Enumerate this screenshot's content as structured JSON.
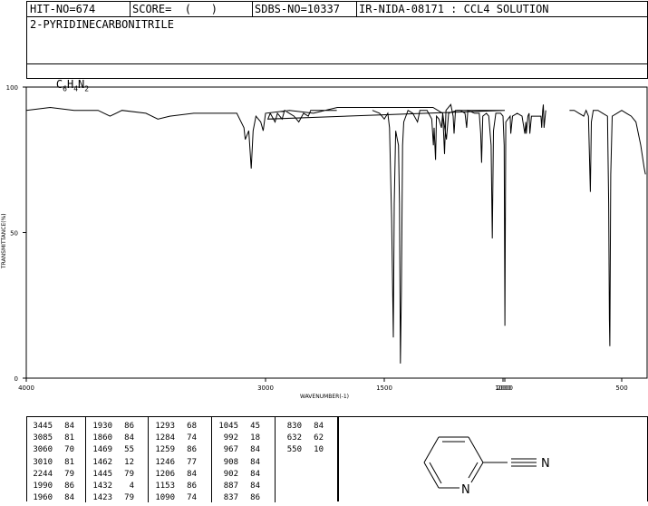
{
  "header": {
    "hit_no": "HIT-NO=674",
    "score": "SCORE=  (   )",
    "sdbs_no": "SDBS-NO=10337",
    "ir_info": "IR-NIDA-08171 : CCL4 SOLUTION"
  },
  "compound": {
    "name": "2-PYRIDINECARBONITRILE",
    "formula_parts": [
      "C",
      "6",
      "H",
      "4",
      "N",
      "2"
    ]
  },
  "chart_data": {
    "type": "line",
    "xlabel": "WAVENUMBER(-1)",
    "ylabel": "TRANSMITTANCE(%)",
    "x_reversed": true,
    "xlim": [
      4000,
      400
    ],
    "ylim": [
      0,
      100
    ],
    "x_ticks": [
      4000,
      3000,
      2000,
      1500,
      1000,
      500
    ],
    "y_ticks": [
      0,
      50,
      100
    ],
    "segments": [
      [
        [
          4000,
          92
        ],
        [
          3900,
          93
        ],
        [
          3800,
          92
        ],
        [
          3700,
          92
        ],
        [
          3650,
          90
        ],
        [
          3600,
          92
        ],
        [
          3500,
          91
        ],
        [
          3450,
          89
        ],
        [
          3400,
          90
        ],
        [
          3300,
          91
        ],
        [
          3200,
          91
        ],
        [
          3120,
          91
        ],
        [
          3090,
          86
        ],
        [
          3085,
          82
        ],
        [
          3070,
          85
        ],
        [
          3060,
          72
        ],
        [
          3052,
          85
        ],
        [
          3040,
          90
        ],
        [
          3020,
          88
        ],
        [
          3010,
          85
        ],
        [
          3000,
          91
        ],
        [
          2900,
          92
        ],
        [
          2800,
          91
        ],
        [
          2700,
          93
        ],
        [
          2500,
          93
        ],
        [
          2300,
          93
        ],
        [
          2260,
          91
        ],
        [
          2244,
          82
        ],
        [
          2235,
          91
        ],
        [
          2200,
          92
        ],
        [
          2100,
          92
        ],
        [
          2050,
          92
        ],
        [
          2000,
          92
        ],
        [
          1990,
          89
        ],
        [
          1980,
          91
        ],
        [
          1960,
          88
        ],
        [
          1950,
          91
        ],
        [
          1930,
          89
        ],
        [
          1920,
          92
        ],
        [
          1900,
          91
        ],
        [
          1880,
          90
        ],
        [
          1860,
          88
        ],
        [
          1840,
          91
        ],
        [
          1820,
          90
        ],
        [
          1810,
          92
        ],
        [
          1780,
          92
        ],
        [
          1700,
          92
        ]
      ],
      [
        [
          1550,
          92
        ],
        [
          1520,
          91
        ],
        [
          1500,
          89
        ],
        [
          1485,
          91
        ],
        [
          1478,
          86
        ],
        [
          1469,
          55
        ],
        [
          1466,
          38
        ],
        [
          1462,
          14
        ],
        [
          1458,
          60
        ],
        [
          1452,
          85
        ],
        [
          1445,
          82
        ],
        [
          1440,
          80
        ],
        [
          1436,
          60
        ],
        [
          1432,
          5
        ],
        [
          1428,
          30
        ],
        [
          1423,
          80
        ],
        [
          1418,
          88
        ],
        [
          1400,
          92
        ],
        [
          1380,
          91
        ],
        [
          1360,
          88
        ],
        [
          1350,
          92
        ],
        [
          1320,
          92
        ],
        [
          1300,
          89
        ],
        [
          1293,
          80
        ],
        [
          1290,
          86
        ],
        [
          1284,
          75
        ],
        [
          1280,
          90
        ],
        [
          1270,
          89
        ],
        [
          1259,
          86
        ],
        [
          1254,
          91
        ],
        [
          1246,
          77
        ],
        [
          1240,
          92
        ],
        [
          1220,
          94
        ],
        [
          1210,
          90
        ],
        [
          1206,
          84
        ],
        [
          1200,
          92
        ],
        [
          1180,
          92
        ],
        [
          1160,
          91
        ],
        [
          1153,
          86
        ],
        [
          1148,
          92
        ],
        [
          1120,
          91
        ],
        [
          1100,
          91
        ],
        [
          1094,
          84
        ],
        [
          1090,
          74
        ],
        [
          1085,
          90
        ],
        [
          1070,
          91
        ],
        [
          1060,
          90
        ],
        [
          1050,
          80
        ],
        [
          1045,
          48
        ],
        [
          1040,
          85
        ],
        [
          1030,
          91
        ],
        [
          1010,
          91
        ],
        [
          1000,
          90
        ],
        [
          995,
          80
        ],
        [
          992,
          18
        ],
        [
          988,
          88
        ],
        [
          970,
          90
        ],
        [
          967,
          84
        ],
        [
          960,
          90
        ],
        [
          940,
          91
        ],
        [
          920,
          90
        ],
        [
          908,
          84
        ],
        [
          904,
          88
        ],
        [
          902,
          84
        ],
        [
          895,
          90
        ],
        [
          890,
          91
        ],
        [
          887,
          84
        ],
        [
          880,
          90
        ],
        [
          860,
          90
        ],
        [
          840,
          90
        ],
        [
          837,
          86
        ],
        [
          833,
          92
        ],
        [
          830,
          94
        ],
        [
          827,
          86
        ],
        [
          820,
          92
        ]
      ],
      [
        [
          720,
          92
        ],
        [
          700,
          92
        ],
        [
          680,
          91
        ],
        [
          660,
          90
        ],
        [
          650,
          92
        ],
        [
          640,
          90
        ],
        [
          634,
          70
        ],
        [
          632,
          64
        ],
        [
          628,
          88
        ],
        [
          620,
          92
        ],
        [
          600,
          92
        ],
        [
          580,
          91
        ],
        [
          560,
          90
        ],
        [
          555,
          60
        ],
        [
          552,
          20
        ],
        [
          550,
          11
        ],
        [
          546,
          70
        ],
        [
          540,
          90
        ],
        [
          520,
          91
        ],
        [
          500,
          92
        ],
        [
          480,
          91
        ],
        [
          460,
          90
        ],
        [
          440,
          88
        ],
        [
          420,
          80
        ],
        [
          405,
          72
        ],
        [
          400,
          70
        ]
      ]
    ]
  },
  "peaks": [
    [
      [
        "3445",
        "84"
      ],
      [
        "3085",
        "81"
      ],
      [
        "3060",
        "70"
      ],
      [
        "3010",
        "81"
      ],
      [
        "2244",
        "79"
      ],
      [
        "1990",
        "86"
      ],
      [
        "1960",
        "84"
      ]
    ],
    [
      [
        "1930",
        "86"
      ],
      [
        "1860",
        "84"
      ],
      [
        "1469",
        "55"
      ],
      [
        "1462",
        "12"
      ],
      [
        "1445",
        "79"
      ],
      [
        "1432",
        "4"
      ],
      [
        "1423",
        "79"
      ]
    ],
    [
      [
        "1293",
        "68"
      ],
      [
        "1284",
        "74"
      ],
      [
        "1259",
        "86"
      ],
      [
        "1246",
        "77"
      ],
      [
        "1206",
        "84"
      ],
      [
        "1153",
        "86"
      ],
      [
        "1090",
        "74"
      ]
    ],
    [
      [
        "1045",
        "45"
      ],
      [
        "992",
        "18"
      ],
      [
        "967",
        "84"
      ],
      [
        "908",
        "84"
      ],
      [
        "902",
        "84"
      ],
      [
        "887",
        "84"
      ],
      [
        "837",
        "86"
      ]
    ],
    [
      [
        "830",
        "84"
      ],
      [
        "632",
        "62"
      ],
      [
        "550",
        "10"
      ]
    ]
  ],
  "structure": {
    "nitrogen_label": "N",
    "nitrile_label": "N"
  }
}
